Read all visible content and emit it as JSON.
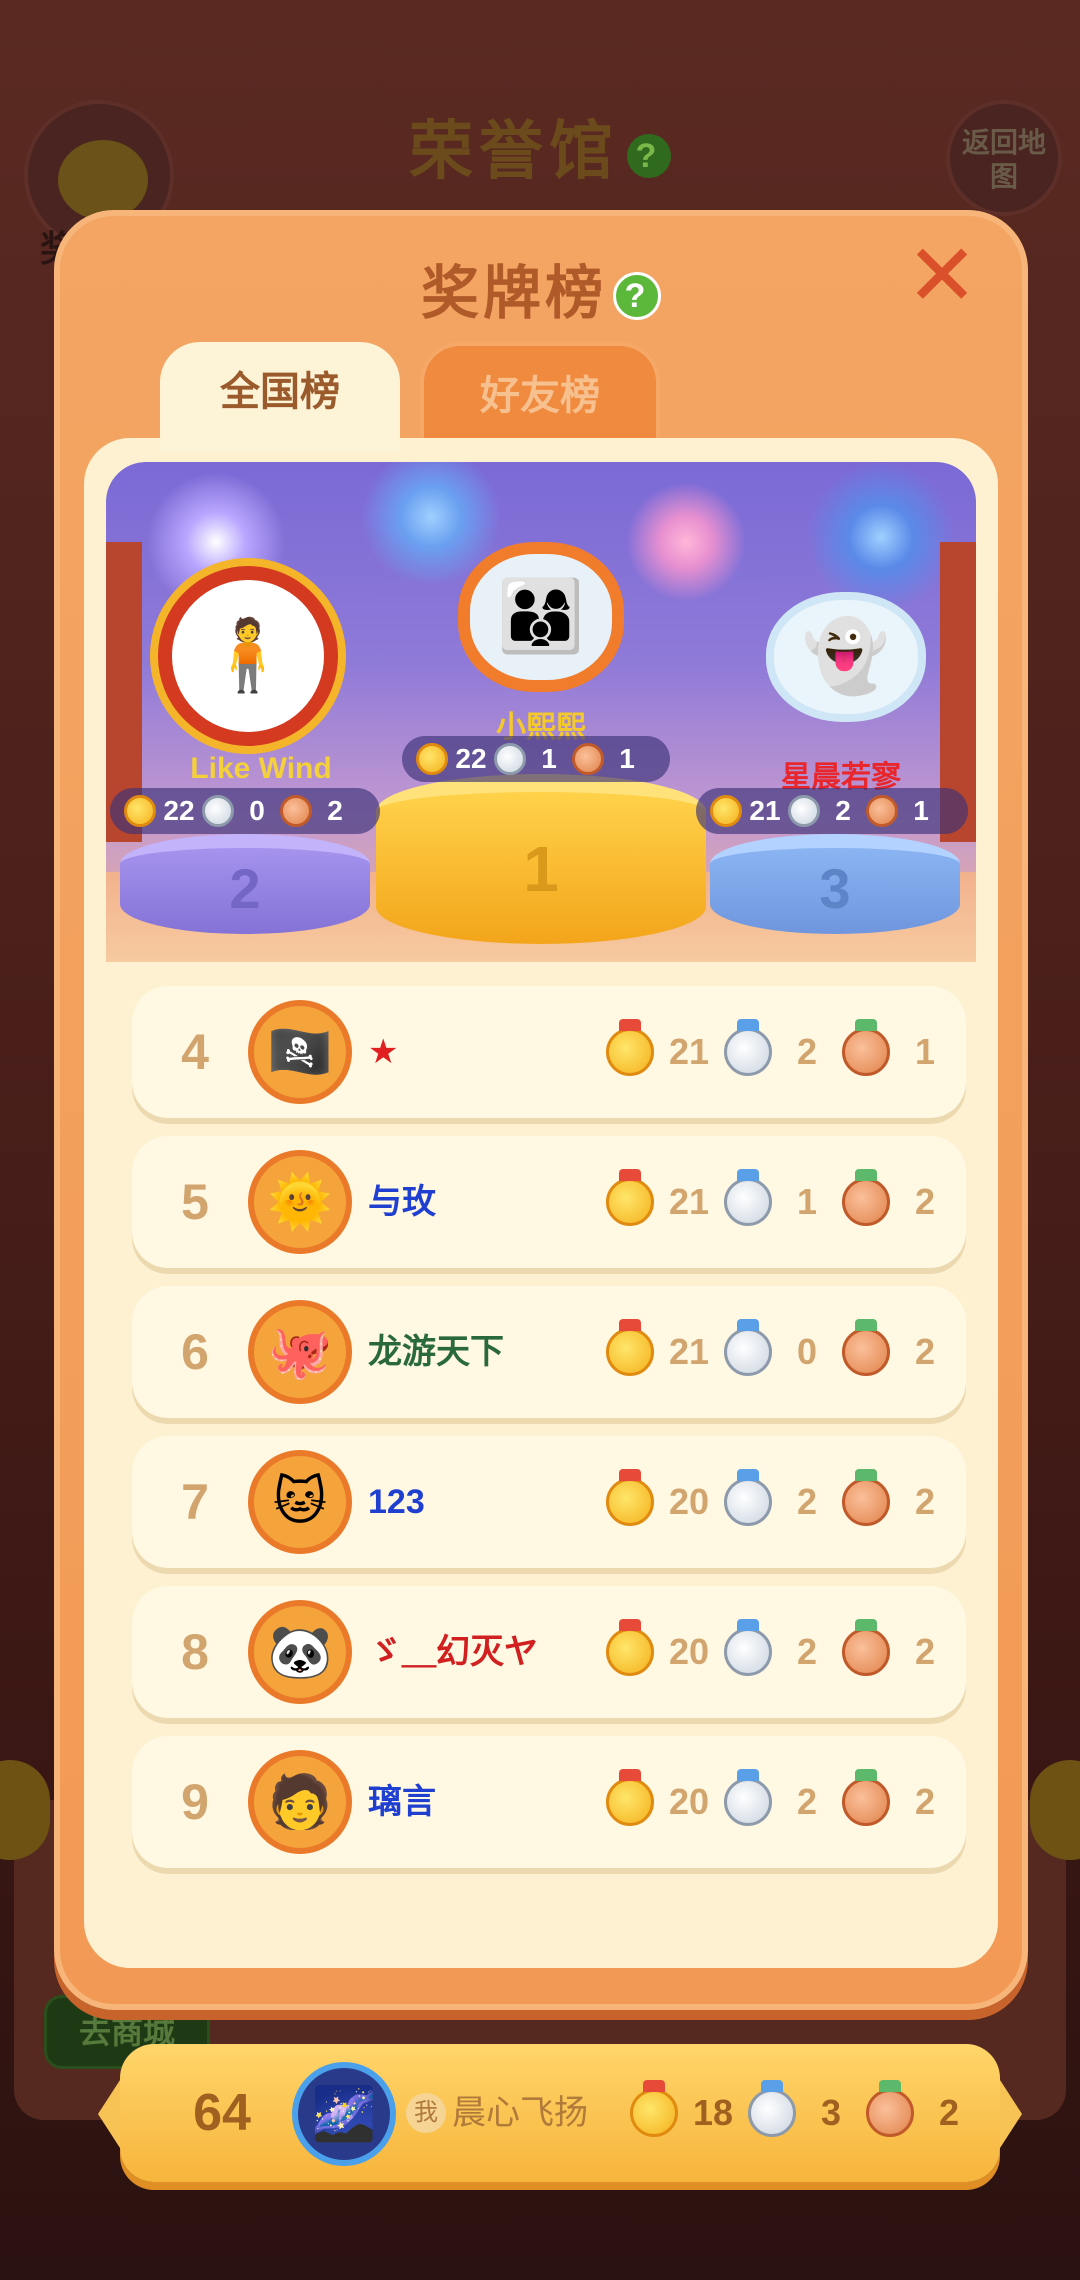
{
  "background": {
    "title": "荣誉馆",
    "back_button": "返回地图",
    "left_label": "奖",
    "shop_button": "去商城"
  },
  "panel": {
    "title": "奖牌榜",
    "help": "?",
    "close": "✕"
  },
  "tabs": [
    {
      "label": "全国榜",
      "active": true
    },
    {
      "label": "好友榜",
      "active": false
    }
  ],
  "podium": [
    {
      "place": "1",
      "name": "小熙熙",
      "gold": "22",
      "silver": "1",
      "bronze": "1"
    },
    {
      "place": "2",
      "name": "Like Wind",
      "gold": "22",
      "silver": "0",
      "bronze": "2"
    },
    {
      "place": "3",
      "name": "星晨若寥",
      "gold": "21",
      "silver": "2",
      "bronze": "1"
    }
  ],
  "rows": [
    {
      "rank": "4",
      "name": "★",
      "gold": "21",
      "silver": "2",
      "bronze": "1",
      "name_color": "#e02020"
    },
    {
      "rank": "5",
      "name": "与玫",
      "gold": "21",
      "silver": "1",
      "bronze": "2",
      "name_color": "#1f3fd0"
    },
    {
      "rank": "6",
      "name": "龙游天下",
      "gold": "21",
      "silver": "0",
      "bronze": "2",
      "name_color": "#2a6a3a"
    },
    {
      "rank": "7",
      "name": "123",
      "gold": "20",
      "silver": "2",
      "bronze": "2",
      "name_color": "#1f3fd0"
    },
    {
      "rank": "8",
      "name": "ゞ＿幻灭ヤ",
      "gold": "20",
      "silver": "2",
      "bronze": "2",
      "name_color": "#d02020"
    },
    {
      "rank": "9",
      "name": "璃言",
      "gold": "20",
      "silver": "2",
      "bronze": "2",
      "name_color": "#1f3fd0"
    }
  ],
  "me": {
    "rank": "64",
    "badge": "我",
    "name": "晨心飞扬",
    "gold": "18",
    "silver": "3",
    "bronze": "2"
  },
  "colors": {
    "panel": "#f29a55",
    "inner": "#fdf1d2",
    "gold_medal": "#f4b01c",
    "silver_medal": "#c9d3df",
    "bronze_medal": "#e0824a"
  },
  "icons": {
    "help": "question-icon",
    "close": "close-icon",
    "medals": [
      "gold-medal-icon",
      "silver-medal-icon",
      "bronze-medal-icon"
    ]
  }
}
